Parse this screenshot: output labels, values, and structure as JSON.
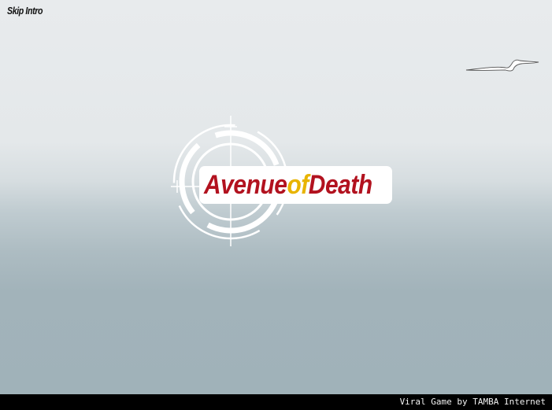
{
  "game": {
    "skip_intro_label": "Skip Intro",
    "title": {
      "part1": "Avenue",
      "part2": "of",
      "part3": "Death"
    },
    "credit": "Viral Game by TAMBA Internet"
  },
  "colors": {
    "title_red": "#b2121f",
    "title_yellow": "#e8b400",
    "sky_top": "#e8ebed",
    "sky_bottom": "#a0b2b9",
    "footer_bg": "#000000"
  },
  "icons": {
    "crosshair": "crosshair-icon",
    "bird": "seagull-icon"
  }
}
